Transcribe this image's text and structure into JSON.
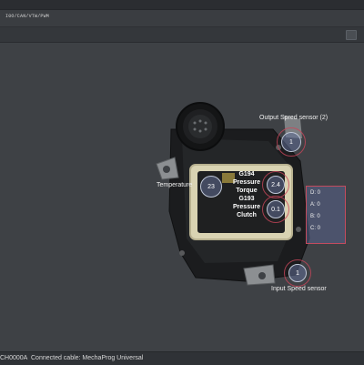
{
  "toolbar": {
    "path_text": "I0O/CAN/VTW/PWM"
  },
  "status": {
    "device_id": "CH0000A",
    "connection_text": "Connected cable: MechaProg Universal"
  },
  "sensors": {
    "output_speed": {
      "label": "Output Spred sensor (2)",
      "value": "1"
    },
    "temperature": {
      "label": "Temperature",
      "value": "23"
    },
    "input_speed": {
      "label": "Input Speed sensor",
      "value": "1"
    }
  },
  "pressures": {
    "g194": {
      "id": "G194",
      "line1": "Pressure",
      "line2": "Torque",
      "value": "2.4"
    },
    "g193": {
      "id": "G193",
      "line1": "Pressure",
      "line2": "Clutch",
      "value": "0.1"
    }
  },
  "clutches": [
    {
      "label": "D: 0"
    },
    {
      "label": "A: 0"
    },
    {
      "label": "B: 0"
    },
    {
      "label": "C: 0"
    }
  ],
  "colors": {
    "accent_ring": "#c34b5e",
    "sensor_fill": "#606e96"
  }
}
